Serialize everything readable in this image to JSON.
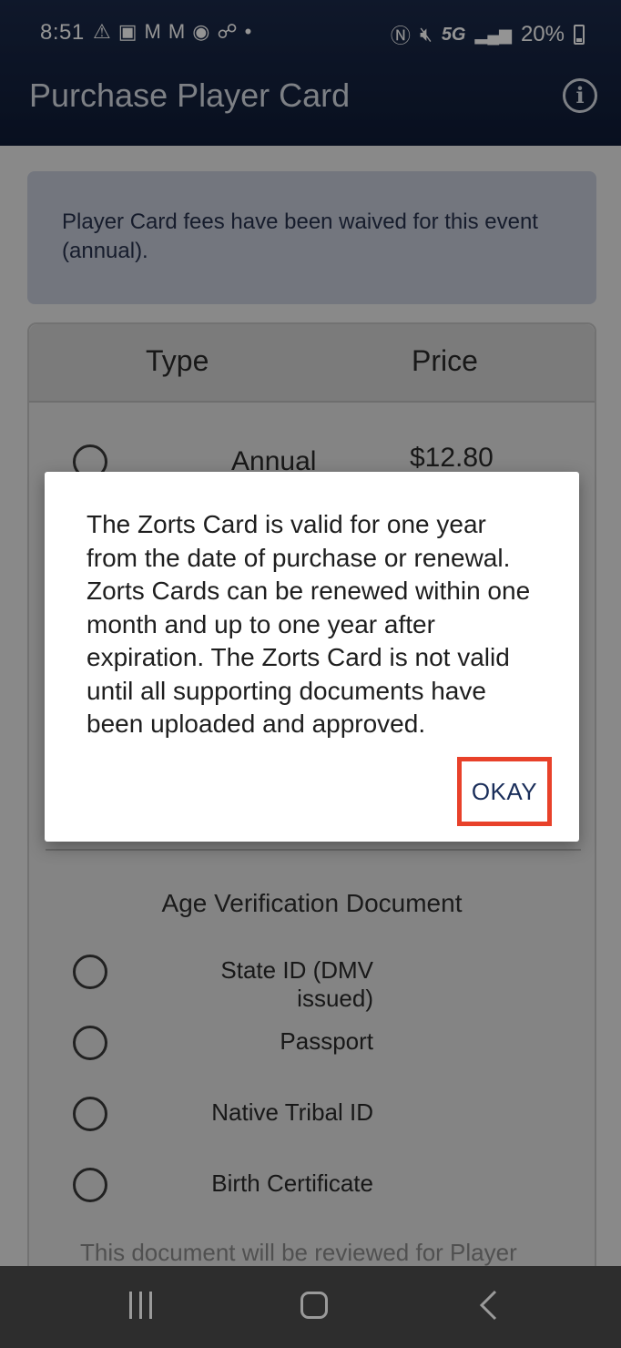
{
  "status_bar": {
    "time": "8:51",
    "left_icons": [
      "warning-icon",
      "voicemail-icon",
      "gmail-icon",
      "gmail-icon",
      "app-icon",
      "missed-call-icon",
      "dot-icon"
    ],
    "network": "5G",
    "battery_percent": "20%"
  },
  "app_bar": {
    "title": "Purchase Player Card",
    "info_icon": "info-icon"
  },
  "banner": {
    "text": "Player Card fees have been waived for this event (annual)."
  },
  "table": {
    "headers": {
      "type": "Type",
      "price": "Price"
    },
    "rows": [
      {
        "type": "Annual",
        "price": "$12.80"
      }
    ]
  },
  "age_verification": {
    "title": "Age Verification Document",
    "options": [
      {
        "label": "State ID (DMV issued)"
      },
      {
        "label": "Passport"
      },
      {
        "label": "Native Tribal ID"
      },
      {
        "label": "Birth Certificate"
      }
    ],
    "note": "This document will be reviewed for Player"
  },
  "dialog": {
    "message": "The Zorts Card is valid for one year from the date of purchase or renewal. Zorts Cards can be renewed within one month and up to one year after expiration. The Zorts Card is not valid until all supporting documents have been uploaded and approved.",
    "confirm_label": "OKAY",
    "highlight_color": "#e8412a"
  },
  "colors": {
    "app_bar": "#0f1b36",
    "banner_bg": "#c6ccda",
    "accent_text": "#1a2e5a"
  }
}
